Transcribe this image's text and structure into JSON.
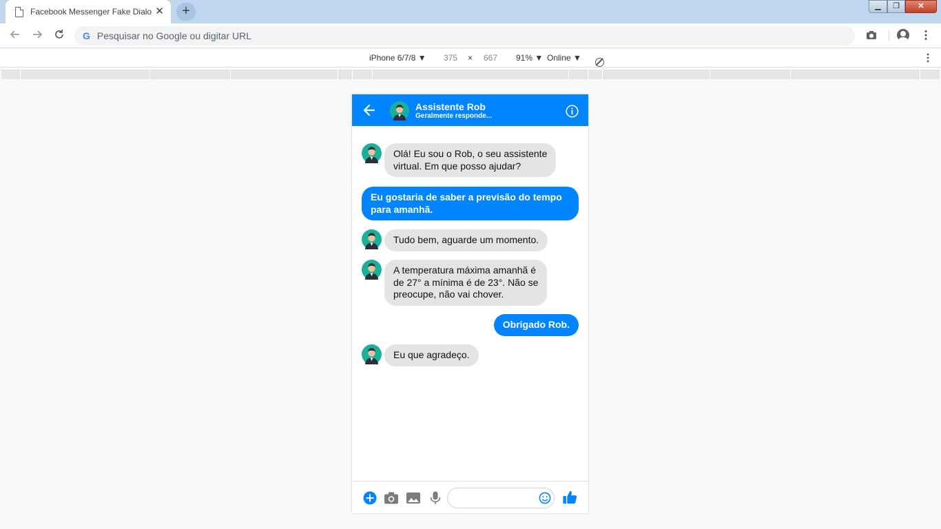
{
  "browser": {
    "tab_title": "Facebook Messenger Fake Dialog",
    "tab_close": "✕",
    "new_tab": "+",
    "window_controls": {
      "minimize": "▁",
      "maximize": "❐",
      "close": "✕"
    },
    "address_placeholder": "Pesquisar no Google ou digitar URL",
    "google_letter": "G"
  },
  "devtools": {
    "device": "iPhone 6/7/8 ▼",
    "width": "375",
    "times": "×",
    "height": "667",
    "zoom": "91% ▼",
    "network": "Online ▼"
  },
  "messenger": {
    "colors": {
      "accent": "#0084ff",
      "incoming_bubble": "#e4e4e4",
      "background": "#ffffff"
    },
    "header": {
      "name": "Assistente Rob",
      "status": "Geralmente responde..."
    },
    "messages": [
      {
        "from": "bot",
        "lines": [
          "Olá! Eu sou o Rob, o seu assistente",
          "virtual. Em que posso ajudar?"
        ]
      },
      {
        "from": "user",
        "lines": [
          "Eu gostaria de saber a previsão do tempo",
          "para amanhã."
        ]
      },
      {
        "from": "bot",
        "lines": [
          "Tudo bem, aguarde um momento."
        ]
      },
      {
        "from": "bot",
        "lines": [
          "A temperatura máxima amanhã é",
          "de 27° a mínima é de 23°. Não se",
          "preocupe, não vai chover."
        ]
      },
      {
        "from": "user",
        "lines": [
          "Obrigado Rob."
        ]
      },
      {
        "from": "bot",
        "lines": [
          "Eu que agradeço."
        ]
      }
    ],
    "footer_icons": [
      "plus-icon",
      "camera-icon",
      "image-icon",
      "microphone-icon",
      "smiley-icon",
      "thumbs-up-icon"
    ]
  }
}
